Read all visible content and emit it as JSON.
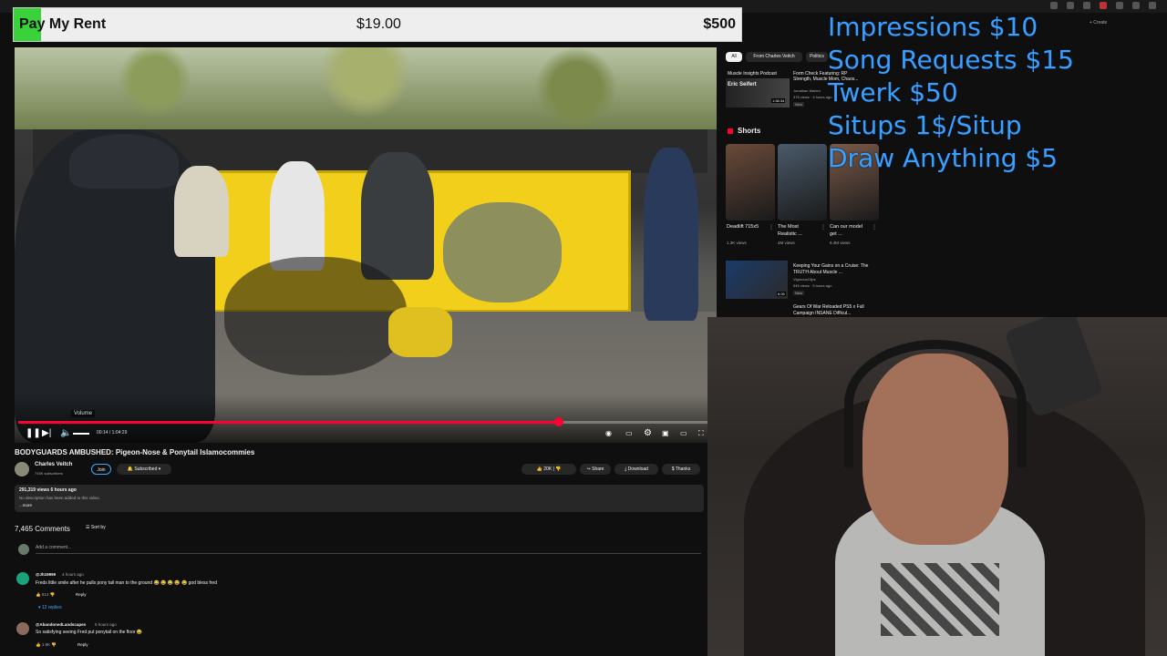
{
  "goal": {
    "title": "Pay My Rent",
    "current": "$19.00",
    "target": "$500",
    "progress_fraction": 0.038,
    "fill_color": "#39d23a"
  },
  "overlay": {
    "price_lines": [
      "Impressions $10",
      "Song Requests $15",
      "Twerk $50",
      "Situps 1$/Situp",
      "Draw Anything $5"
    ],
    "text_color": "#3aa0ff"
  },
  "player": {
    "volume_tooltip": "Volume",
    "time": "00:14 / 1:04:29",
    "progress_fraction": 0.78,
    "accent": "#ff0033",
    "icons": [
      "pause-icon",
      "next-icon",
      "volume-icon",
      "autoplay-toggle",
      "captions-icon",
      "settings-gear-icon",
      "miniplayer-icon",
      "theater-icon",
      "fullscreen-icon"
    ]
  },
  "video": {
    "title": "BODYGUARDS AMBUSHED: Pigeon-Nose & Ponytail Islamocommies",
    "channel": "Charles Veitch",
    "subscribers": "745K subscribers",
    "join_label": "Join",
    "subscribed_label": "Subscribed",
    "likes": "20K",
    "share_label": "Share",
    "download_label": "Download",
    "thanks_label": "Thanks",
    "stats": "291,319 views  6 hours ago",
    "description": "No description has been added to this video.",
    "more_label": "...more"
  },
  "comments": {
    "count_label": "7,465 Comments",
    "sort_label": "Sort by",
    "add_placeholder": "Add a comment...",
    "items": [
      {
        "user": "@Jh19999",
        "age": "4 hours ago",
        "text": "Freds little smile after he pulls pony tail man to the ground 😂 😂 😂 😂 😂 god bless fred",
        "likes": "813",
        "reply_label": "Reply",
        "replies": "12 replies",
        "avatar_color": "#1aa37a"
      },
      {
        "user": "@AbandonedLandscapes",
        "age": "5 hours ago",
        "text": "So satisfying seeing Fred put ponytail on the floor 😂",
        "likes": "1.9K",
        "reply_label": "Reply",
        "avatar_color": "#8a6a5a"
      }
    ]
  },
  "sidebar": {
    "header_create": "+ Create",
    "chips": [
      "All",
      "From Charles Veitch",
      "Politics"
    ],
    "rec_top": {
      "label": "Muscle Insights Podcast",
      "name": "Eric Seifert",
      "duration": "1:58:34",
      "side_title": "Form Check Featuring: RP Strength, Muscle Mom, Chaos...",
      "side_meta": "Jonathan Marlen",
      "side_meta2": "378 views · 4 hours ago",
      "badge": "New"
    },
    "shorts_label": "Shorts",
    "shorts": [
      {
        "title": "Deadlift 715x5",
        "views": "1.3K views",
        "color": "#6a4a3a"
      },
      {
        "title": "The Most Realistic ...",
        "views": "4M views",
        "color": "#4a5a6a"
      },
      {
        "title": "Can our model get ...",
        "views": "8.4M views",
        "color": "#7a5a4a"
      }
    ],
    "rec_bottom": {
      "title": "Keeping Your Gains on a Cruise: The TRUTH About Muscle ...",
      "channel": "VigorousClips",
      "meta": "545 views · 5 hours ago",
      "badge": "New",
      "duration": "6:05"
    },
    "rec_next_title": "Gears Of War Reloaded PS5 x Full Campaign INSANE Difficul..."
  }
}
